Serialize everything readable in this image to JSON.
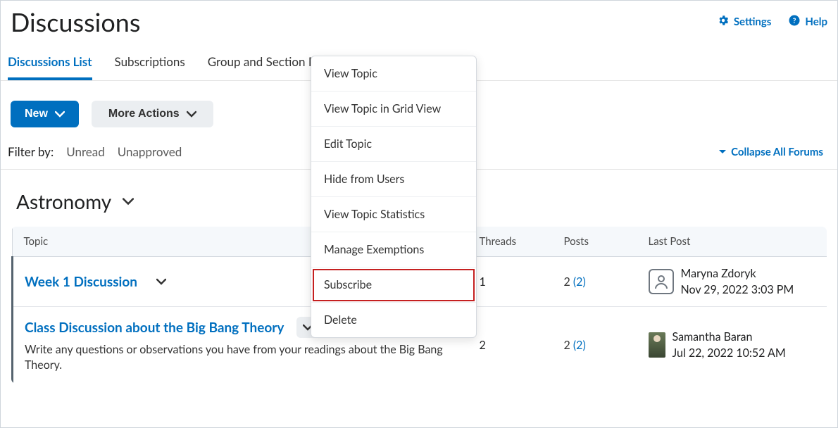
{
  "header": {
    "title": "Discussions",
    "links": {
      "settings": "Settings",
      "help": "Help"
    }
  },
  "tabs": [
    {
      "label": "Discussions List",
      "active": true
    },
    {
      "label": "Subscriptions",
      "active": false
    },
    {
      "label": "Group and Section Restrictions",
      "active": false
    }
  ],
  "toolbar": {
    "new_label": "New",
    "more_actions_label": "More Actions"
  },
  "filter": {
    "label": "Filter by:",
    "unread": "Unread",
    "unapproved": "Unapproved",
    "collapse": "Collapse All Forums"
  },
  "forum": {
    "title": "Astronomy"
  },
  "table": {
    "headers": {
      "topic": "Topic",
      "threads": "Threads",
      "posts": "Posts",
      "last_post": "Last Post"
    },
    "rows": [
      {
        "title": "Week 1 Discussion",
        "desc": "",
        "threads": "1",
        "posts": "2",
        "unread": "(2)",
        "last_post_name": "Maryna Zdoryk",
        "last_post_date": "Nov 29, 2022 3:03 PM",
        "avatar": "generic"
      },
      {
        "title": "Class Discussion about the Big Bang Theory",
        "desc": "Write any questions or observations you have from your readings about the Big Bang Theory.",
        "threads": "2",
        "posts": "2",
        "unread": "(2)",
        "last_post_name": "Samantha Baran",
        "last_post_date": "Jul 22, 2022 10:52 AM",
        "avatar": "photo"
      }
    ]
  },
  "dropdown": {
    "items": [
      "View Topic",
      "View Topic in Grid View",
      "Edit Topic",
      "Hide from Users",
      "View Topic Statistics",
      "Manage Exemptions",
      "Subscribe",
      "Delete"
    ],
    "highlight_index": 6
  }
}
